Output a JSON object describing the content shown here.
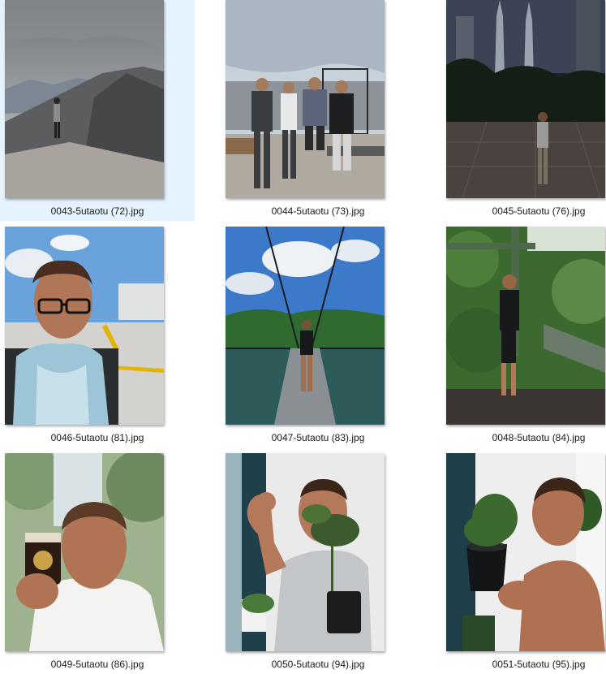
{
  "files": [
    {
      "name": "0043-5utaotu (72).jpg",
      "selected": true,
      "thumbnail": "man-on-volcano-ridge"
    },
    {
      "name": "0044-5utaotu (73).jpg",
      "selected": false,
      "thumbnail": "four-men-rooftop"
    },
    {
      "name": "0045-5utaotu (76).jpg",
      "selected": false,
      "thumbnail": "man-night-city-towers"
    },
    {
      "name": "0046-5utaotu (81).jpg",
      "selected": false,
      "thumbnail": "man-glasses-street-selfie"
    },
    {
      "name": "0047-5utaotu (83).jpg",
      "selected": false,
      "thumbnail": "man-suspension-bridge"
    },
    {
      "name": "0048-5utaotu (84).jpg",
      "selected": false,
      "thumbnail": "man-canopy-walkway"
    },
    {
      "name": "0049-5utaotu (86).jpg",
      "selected": false,
      "thumbnail": "man-bubble-tea"
    },
    {
      "name": "0050-5utaotu (94).jpg",
      "selected": false,
      "thumbnail": "man-flexing-with-plant"
    },
    {
      "name": "0051-5utaotu (95).jpg",
      "selected": false,
      "thumbnail": "shirtless-man-with-plant"
    }
  ],
  "colors": {
    "selection_bg": "#e5f3ff",
    "caption_text": "#1a1a1a"
  }
}
